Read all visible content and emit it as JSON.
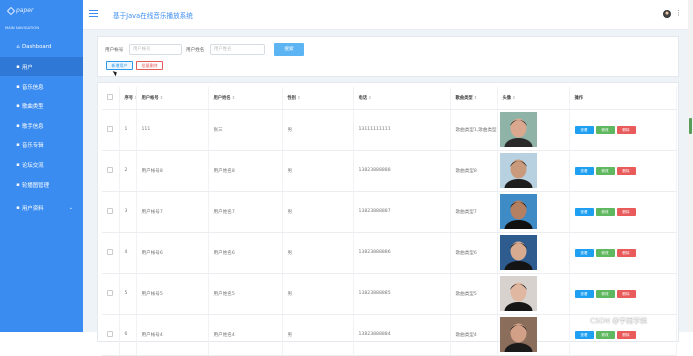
{
  "brand": {
    "logo_text": "paper"
  },
  "sidebar": {
    "caption": "MAIN NAVIGATION",
    "items": [
      {
        "label": "Dashboard",
        "icon": "home-icon",
        "glyph": "⌂",
        "active": false
      },
      {
        "label": "用户",
        "icon": "user-icon",
        "glyph": "▪",
        "active": true
      },
      {
        "label": "音乐信息",
        "icon": "music-icon",
        "glyph": "▪",
        "active": false
      },
      {
        "label": "歌曲类型",
        "icon": "type-icon",
        "glyph": "▪",
        "active": false
      },
      {
        "label": "歌手信息",
        "icon": "singer-icon",
        "glyph": "▪",
        "active": false
      },
      {
        "label": "音乐专辑",
        "icon": "album-icon",
        "glyph": "▪",
        "active": false
      },
      {
        "label": "论坛交流",
        "icon": "forum-icon",
        "glyph": "▪",
        "active": false
      },
      {
        "label": "轮播图管理",
        "icon": "carousel-icon",
        "glyph": "▪",
        "active": false
      },
      {
        "label": "用户资料",
        "icon": "profile-icon",
        "glyph": "▪",
        "active": false,
        "has_chevron": true
      }
    ]
  },
  "header": {
    "title": "基于Java在线音乐播放系统",
    "more_glyph": "⋮"
  },
  "filter": {
    "account_label": "用户帐号",
    "account_placeholder": "用户帐号",
    "name_label": "用户姓名",
    "name_placeholder": "用户姓名",
    "search_label": "搜索",
    "add_label": "新增用户",
    "bulk_delete_label": "批量删除"
  },
  "table": {
    "headers": [
      "",
      "序号",
      "用户帐号",
      "用户姓名",
      "性别",
      "电话",
      "歌曲类型",
      "头像",
      "操作"
    ],
    "rows": [
      {
        "index": "1",
        "account": "111",
        "name": "张三",
        "gender": "男",
        "phone": "13111111111",
        "song_type": "歌曲类型1,歌曲类型2"
      },
      {
        "index": "2",
        "account": "用户帐号8",
        "name": "用户姓名8",
        "gender": "男",
        "phone": "13823888888",
        "song_type": "歌曲类型8"
      },
      {
        "index": "3",
        "account": "用户帐号7",
        "name": "用户姓名7",
        "gender": "男",
        "phone": "13823888887",
        "song_type": "歌曲类型7"
      },
      {
        "index": "4",
        "account": "用户帐号6",
        "name": "用户姓名6",
        "gender": "男",
        "phone": "13823888886",
        "song_type": "歌曲类型6"
      },
      {
        "index": "5",
        "account": "用户帐号5",
        "name": "用户姓名5",
        "gender": "男",
        "phone": "13823888885",
        "song_type": "歌曲类型5"
      },
      {
        "index": "6",
        "account": "用户帐号4",
        "name": "用户姓名4",
        "gender": "男",
        "phone": "13823888884",
        "song_type": "歌曲类型4"
      }
    ],
    "actions": {
      "view": "查看",
      "edit": "修改",
      "delete": "删除"
    }
  },
  "watermark": "CSDN @宇雨学姐"
}
